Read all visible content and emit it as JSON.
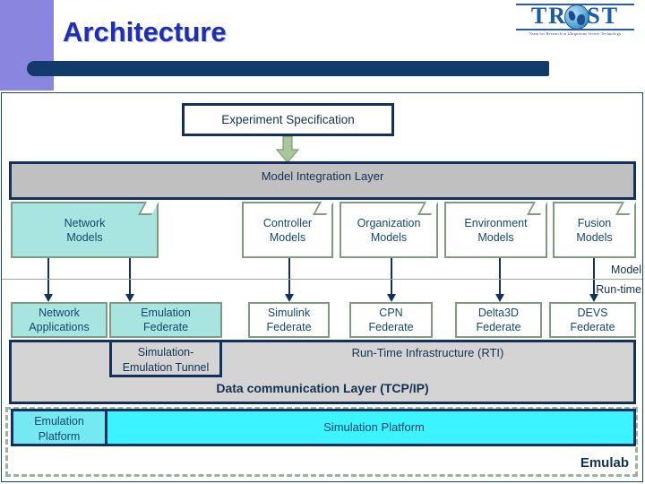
{
  "slide": {
    "title": "Architecture",
    "logo": {
      "wordmark": "TRUST",
      "letters_before": "TR",
      "letters_after": "ST",
      "tagline": "Team for Research in Ubiquitous Secure Technology",
      "globe_icon": "globe-icon"
    }
  },
  "diagram": {
    "experiment_spec": "Experiment Specification",
    "flow_arrow": "down-arrow-green",
    "model_integration_layer": "Model Integration Layer",
    "models": [
      {
        "line1": "Network",
        "line2": "Models",
        "filled": true
      },
      {
        "line1": "Controller",
        "line2": "Models",
        "filled": false
      },
      {
        "line1": "Organization",
        "line2": "Models",
        "filled": false
      },
      {
        "line1": "Environment",
        "line2": "Models",
        "filled": false
      },
      {
        "line1": "Fusion",
        "line2": "Models",
        "filled": false
      }
    ],
    "side_labels": {
      "upper": "Model",
      "lower": "Run-time"
    },
    "federates": [
      {
        "line1": "Network",
        "line2": "Applications",
        "filled": true
      },
      {
        "line1": "Emulation",
        "line2": "Federate",
        "filled": true
      },
      {
        "line1": "Simulink",
        "line2": "Federate",
        "filled": false
      },
      {
        "line1": "CPN",
        "line2": "Federate",
        "filled": false
      },
      {
        "line1": "Delta3D",
        "line2": "Federate",
        "filled": false
      },
      {
        "line1": "DEVS",
        "line2": "Federate",
        "filled": false
      }
    ],
    "tunnel": {
      "line1": "Simulation-",
      "line2": "Emulation Tunnel"
    },
    "rti": "Run-Time Infrastructure (RTI)",
    "data_communication_layer": "Data communication Layer (TCP/IP)",
    "emulation_platform": {
      "line1": "Emulation",
      "line2": "Platform"
    },
    "simulation_platform": "Simulation Platform",
    "emulab": "Emulab"
  },
  "colors": {
    "title_blue": "#1c2fb5",
    "bar_navy": "#123a6b",
    "sidebar_purple": "#8a86e0",
    "box_border_navy": "#14305c",
    "box_border_green": "#7e9b7e",
    "fill_cyan": "#a8e4e0",
    "platform_cyan": "#3bf4ff",
    "layer_gray": "#c0c0c0",
    "band_gray": "#d4d4d4",
    "arrow_green": "#a9c79a",
    "dashed_green": "#9bb39b"
  }
}
